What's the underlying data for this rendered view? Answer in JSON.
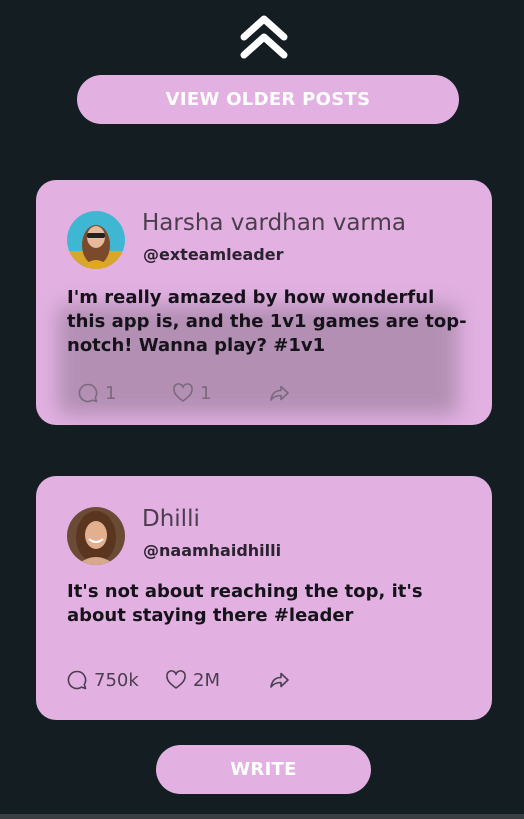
{
  "nav": {
    "scroll_up_icon": "double-chevron-up-icon",
    "older_posts_label": "VIEW OLDER POSTS",
    "write_label": "WRITE"
  },
  "posts": [
    {
      "author_name": "Harsha vardhan varma",
      "handle": "@exteamleader",
      "text": "I'm really amazed by how wonderful this app is, and the 1v1 games are top-notch! Wanna play? #1v1",
      "comments": "1",
      "likes": "1"
    },
    {
      "author_name": "Dhilli",
      "handle": "@naamhaidhilli",
      "text": "It's not about reaching the top, it's about staying there #leader",
      "comments": "750k",
      "likes": "2M"
    }
  ],
  "colors": {
    "background": "#141d22",
    "accent": "#e2b1e2",
    "button_text": "#ffffff"
  },
  "icons": [
    "double-chevron-up-icon",
    "comment-icon",
    "heart-icon",
    "share-icon"
  ]
}
